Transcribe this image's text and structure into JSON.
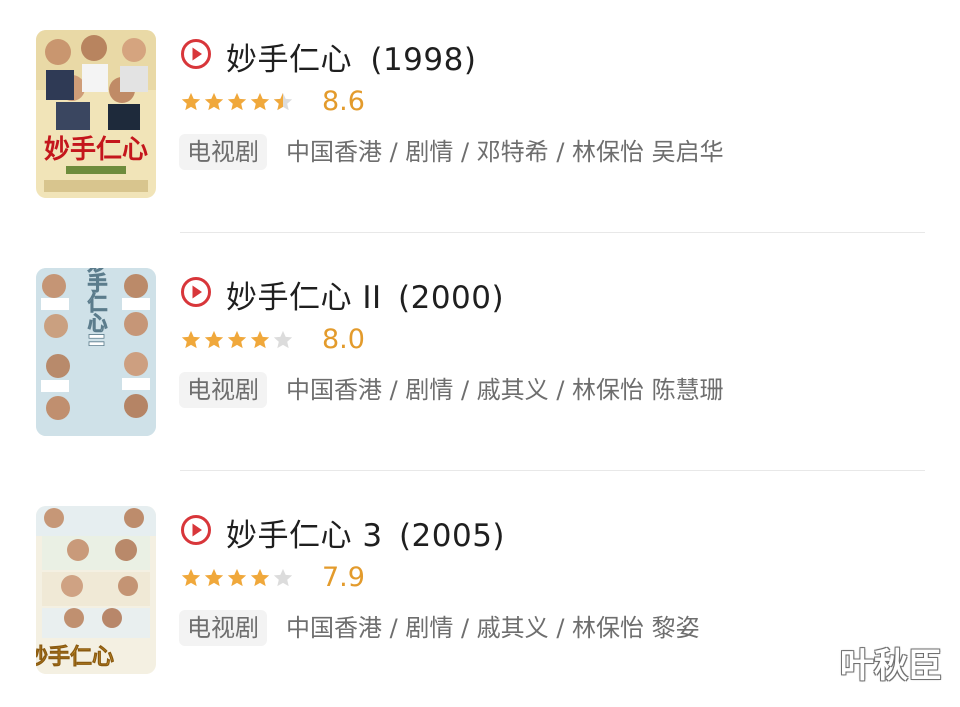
{
  "colors": {
    "accent": "#d8363a",
    "star": "#f0a83b",
    "star_empty": "#dcdcdc",
    "score": "#e39b2c"
  },
  "results": [
    {
      "poster_caption": "妙手仁心",
      "title": "妙手仁心",
      "year": "(1998)",
      "rating_stars": 4.5,
      "score": "8.6",
      "type_tag": "电视剧",
      "meta": "中国香港 / 剧情 / 邓特希 / 林保怡 吴启华",
      "play_icon": "play-circle-icon"
    },
    {
      "poster_caption": "妙手仁心II",
      "title": "妙手仁心 II",
      "year": "(2000)",
      "rating_stars": 4,
      "score": "8.0",
      "type_tag": "电视剧",
      "meta": "中国香港 / 剧情 / 戚其义 / 林保怡 陈慧珊",
      "play_icon": "play-circle-icon"
    },
    {
      "poster_caption": "妙手仁心",
      "title": "妙手仁心 3",
      "year": "(2005)",
      "rating_stars": 4,
      "score": "7.9",
      "type_tag": "电视剧",
      "meta": "中国香港 / 剧情 / 戚其义 / 林保怡 黎姿",
      "play_icon": "play-circle-icon"
    }
  ],
  "watermark": "叶秋臣"
}
